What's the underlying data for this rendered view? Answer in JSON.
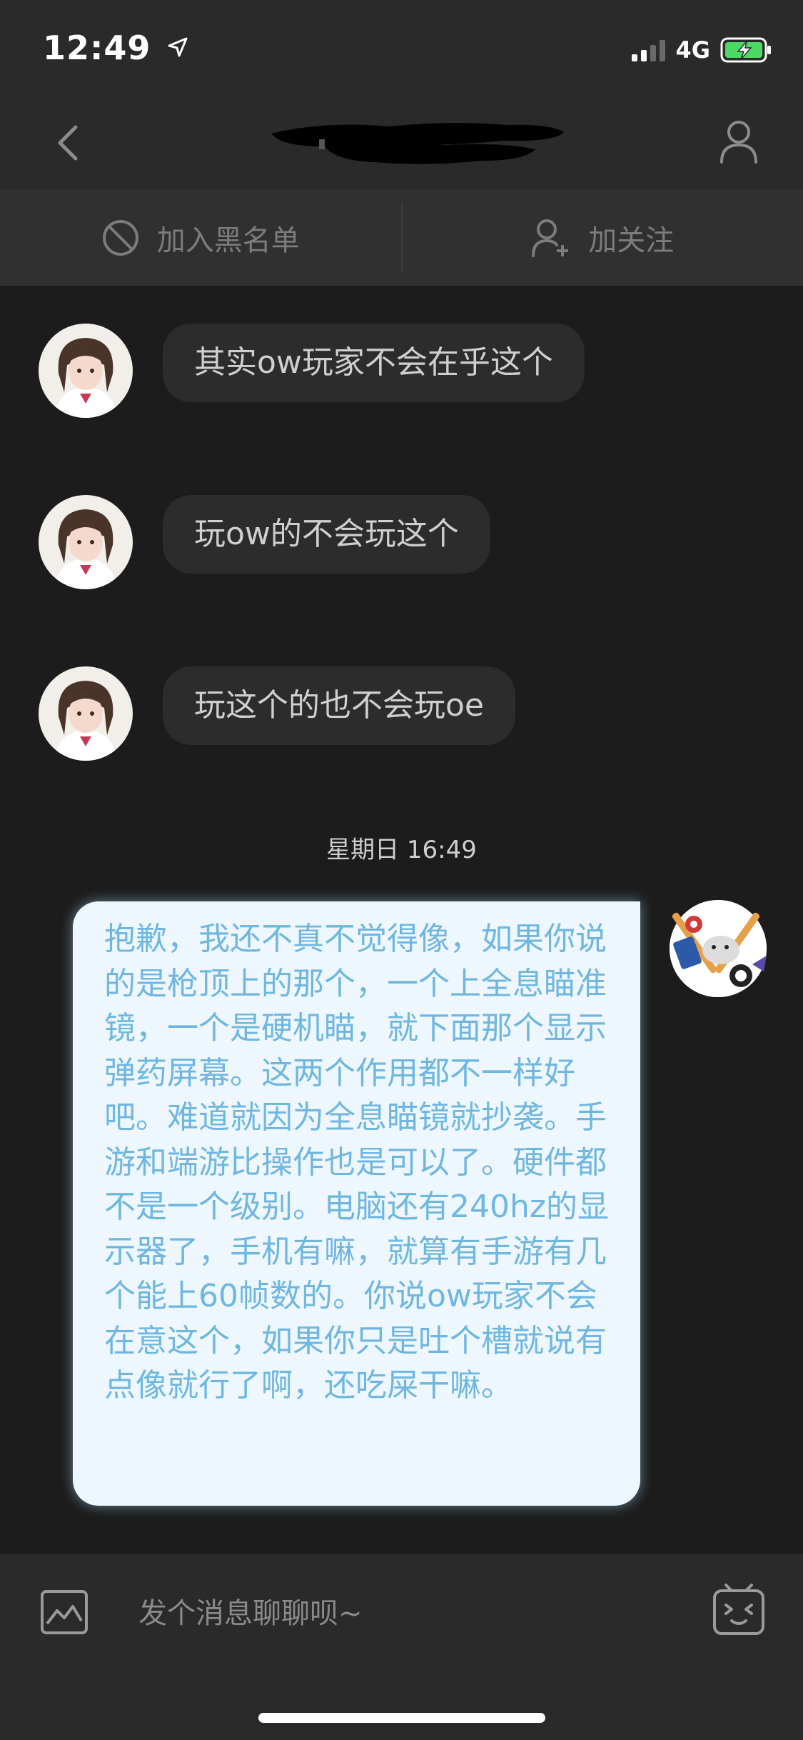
{
  "status_bar": {
    "time": "12:49",
    "network": "4G",
    "location_icon": "location-arrow-icon",
    "battery_icon": "battery-charging-icon"
  },
  "header": {
    "back_icon": "chevron-left-icon",
    "profile_icon": "person-icon"
  },
  "action_bar": {
    "blacklist_label": "加入黑名单",
    "blacklist_icon": "block-icon",
    "follow_label": "加关注",
    "follow_icon": "add-person-icon"
  },
  "messages": [
    {
      "sender": "other",
      "text": "其实ow玩家不会在乎这个"
    },
    {
      "sender": "other",
      "text": "玩ow的不会玩这个"
    },
    {
      "sender": "other",
      "text": "玩这个的也不会玩oe"
    }
  ],
  "time_separator": "星期日 16:49",
  "outgoing_message": {
    "sender": "self",
    "text": "抱歉，我还不真不觉得像，如果你说的是枪顶上的那个，一个上全息瞄准镜，一个是硬机瞄，就下面那个显示弹药屏幕。这两个作用都不一样好吧。难道就因为全息瞄镜就抄袭。手游和端游比操作也是可以了。硬件都不是一个级别。电脑还有240hz的显示器了，手机有嘛，就算有手游有几个能上60帧数的。你说ow玩家不会在意这个，如果你只是吐个槽就说有点像就行了啊，还吃屎干嘛。"
  },
  "input_bar": {
    "placeholder": "发个消息聊聊呗~",
    "value": "",
    "image_icon": "image-icon",
    "emoji_icon": "emoji-face-icon"
  },
  "colors": {
    "background": "#1c1c1c",
    "bar": "#2a2a2a",
    "incoming_bubble": "#2c2c2c",
    "outgoing_bubble": "#eef7fd",
    "outgoing_text": "#6fb7e0"
  }
}
